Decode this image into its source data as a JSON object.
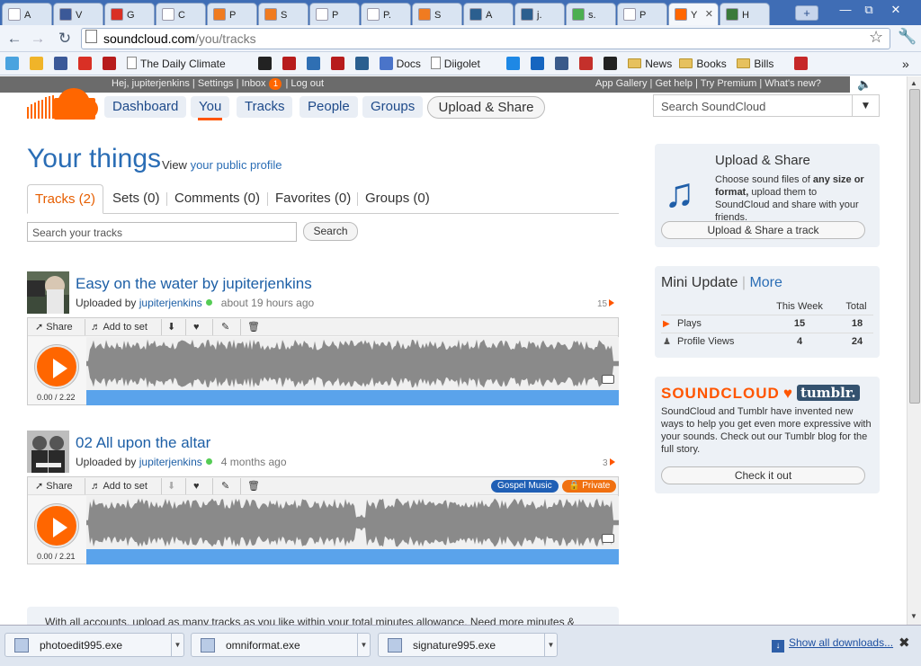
{
  "browser": {
    "tabs": [
      {
        "label": "A",
        "icon": "page-icon",
        "color": "#ffffff"
      },
      {
        "label": "V",
        "icon": "facebook-icon",
        "color": "#3b5998"
      },
      {
        "label": "G",
        "icon": "gmail-icon",
        "color": "#d93025"
      },
      {
        "label": "C",
        "icon": "page-icon",
        "color": "#ffffff"
      },
      {
        "label": "P",
        "icon": "pdf-icon",
        "color": "#f07b20"
      },
      {
        "label": "S",
        "icon": "pdf-icon",
        "color": "#f07b20"
      },
      {
        "label": "P",
        "icon": "page-icon",
        "color": "#ffffff"
      },
      {
        "label": "P.",
        "icon": "page-icon",
        "color": "#ffffff"
      },
      {
        "label": "S",
        "icon": "pdf-icon",
        "color": "#f07b20"
      },
      {
        "label": "A",
        "icon": "sheet-icon",
        "color": "#2b5f8f"
      },
      {
        "label": "j.",
        "icon": "sheet-icon",
        "color": "#2b5f8f"
      },
      {
        "label": "s.",
        "icon": "google-icon",
        "color": "#4caf50"
      },
      {
        "label": "P",
        "icon": "page-icon",
        "color": "#ffffff"
      },
      {
        "label": "Y",
        "icon": "soundcloud-icon",
        "color": "#ff6600"
      },
      {
        "label": "H",
        "icon": "h-icon",
        "color": "#3a7a3a"
      }
    ],
    "url_host": "soundcloud.com",
    "url_path": "/you/tracks",
    "bookmarks": [
      {
        "label": "",
        "icon": "twitter-icon"
      },
      {
        "label": "",
        "icon": "weather-icon"
      },
      {
        "label": "",
        "icon": "facebook-icon"
      },
      {
        "label": "",
        "icon": "gmail-icon"
      },
      {
        "label": "",
        "icon": "target-icon"
      },
      {
        "label": "The Daily Climate",
        "icon": "page-icon"
      },
      {
        "label": "",
        "icon": "bird-icon"
      },
      {
        "label": "",
        "icon": "target-icon"
      },
      {
        "label": "",
        "icon": "otm-icon"
      },
      {
        "label": "",
        "icon": "target-icon"
      },
      {
        "label": "",
        "icon": "grid-icon"
      },
      {
        "label": "Docs",
        "icon": "docs-icon"
      },
      {
        "label": "Diigolet",
        "icon": "page-icon"
      },
      {
        "label": "",
        "icon": "d-icon"
      },
      {
        "label": "",
        "icon": "six-icon"
      },
      {
        "label": "",
        "icon": "stripes-icon"
      },
      {
        "label": "",
        "icon": "youtube-icon"
      },
      {
        "label": "",
        "icon": "amazon-icon"
      },
      {
        "label": "News",
        "icon": "folder-icon"
      },
      {
        "label": "Books",
        "icon": "folder-icon"
      },
      {
        "label": "Bills",
        "icon": "folder-icon"
      },
      {
        "label": "",
        "icon": "bb-icon"
      }
    ],
    "more_bookmarks": "»"
  },
  "site": {
    "userbar": {
      "greeting": "Hej,",
      "username": "jupiterjenkins",
      "settings": "Settings",
      "inbox": "Inbox",
      "inbox_count": "1",
      "logout": "Log out"
    },
    "toplinks": "App Gallery | Get help | Try Premium | What's new?",
    "nav": [
      "Dashboard",
      "You",
      "Tracks",
      "People",
      "Groups"
    ],
    "upload_button": "Upload & Share",
    "search_placeholder": "Search SoundCloud",
    "accent": "#ff5500"
  },
  "main": {
    "title": "Your things",
    "view_prefix": "View",
    "view_link": "your public profile",
    "subtabs": [
      "Tracks (2)",
      "Sets (0)",
      "Comments (0)",
      "Favorites (0)",
      "Groups (0)"
    ],
    "search_placeholder": "Search your tracks",
    "search_button": "Search",
    "tracks": [
      {
        "title": "Easy on the water by jupiterjenkins",
        "uploaded_by": "Uploaded by",
        "user": "jupiterjenkins",
        "ago": "about 19 hours ago",
        "plays": "15",
        "time": "0.00 / 2.22",
        "share": "Share",
        "add": "Add to set",
        "tags": []
      },
      {
        "title": "02 All upon the altar",
        "uploaded_by": "Uploaded by",
        "user": "jupiterjenkins",
        "ago": "4 months ago",
        "plays": "3",
        "time": "0.00 / 2.21",
        "share": "Share",
        "add": "Add to set",
        "tags": [
          "Gospel Music",
          "Private"
        ]
      }
    ],
    "footer_text": "With all accounts, upload as many tracks as you like within your total minutes allowance. Need more minutes &"
  },
  "sidebar": {
    "upload": {
      "title": "Upload & Share",
      "text_1": "Choose sound files of",
      "text_bold": "any size or format,",
      "text_2": "upload them to SoundCloud and share with your friends.",
      "button": "Upload & Share a track"
    },
    "mini": {
      "title": "Mini Update",
      "more": "More",
      "col1": "This Week",
      "col2": "Total",
      "rows": [
        {
          "label": "Plays",
          "week": "15",
          "total": "18"
        },
        {
          "label": "Profile Views",
          "week": "4",
          "total": "24"
        }
      ]
    },
    "tumblr": {
      "soundcloud": "SOUNDCLOUD",
      "tumblr": "tumblr.",
      "text": "SoundCloud and Tumblr have invented new ways to help you get even more expressive with your sounds. Check out our Tumblr blog for the full story.",
      "button": "Check it out"
    }
  },
  "downloads": {
    "items": [
      "photoedit995.exe",
      "omniformat.exe",
      "signature995.exe"
    ],
    "show_all": "Show all downloads..."
  }
}
